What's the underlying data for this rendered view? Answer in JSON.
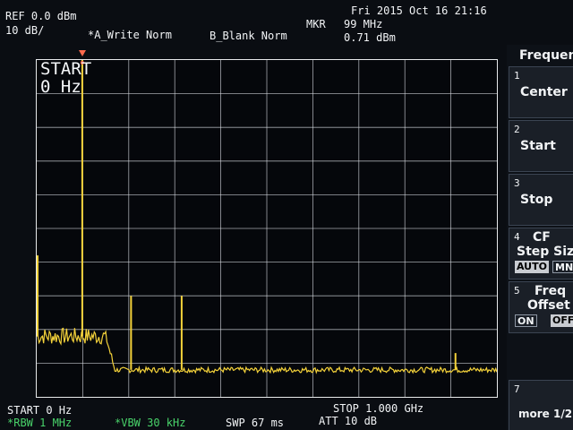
{
  "header": {
    "ref_level": "REF 0.0 dBm",
    "scale": "10 dB/",
    "trace_a": "*A_Write Norm",
    "trace_b": "B_Blank Norm",
    "datetime": "Fri 2015 Oct 16 21:16",
    "marker_label": "MKR",
    "marker_freq": "99 MHz",
    "marker_level": "0.71 dBm"
  },
  "plot_overlay": {
    "line1": "START",
    "line2": "0 Hz"
  },
  "footer": {
    "start": "START 0 Hz",
    "stop": "STOP 1.000 GHz",
    "rbw": "*RBW 1 MHz",
    "vbw": "*VBW 30 kHz",
    "sweep": "SWP 67 ms",
    "atten": "ATT 10 dB"
  },
  "softkeys": {
    "menu_title": "Frequency",
    "keys": [
      {
        "num": "1",
        "label": "Center"
      },
      {
        "num": "2",
        "label": "Start"
      },
      {
        "num": "3",
        "label": "Stop"
      },
      {
        "num": "4",
        "label_line1": "CF",
        "label_line2": "Step Size",
        "opt_on": "AUTO",
        "opt_off": "MNL"
      },
      {
        "num": "5",
        "label_line1": "Freq",
        "label_line2": "Offset",
        "opt_on": "ON",
        "opt_off": "OFF"
      },
      {
        "num": "7",
        "label": "more 1/2"
      }
    ]
  },
  "colors": {
    "trace": "#f4d23a",
    "grid": "#d9dde2",
    "marker": "#ff6a4d",
    "status_green": "#49d36a"
  },
  "chart_data": {
    "type": "line",
    "xlabel": "",
    "ylabel": "",
    "x_unit": "MHz",
    "y_unit": "dBm",
    "xlim": [
      0,
      1000
    ],
    "ylim": [
      -100,
      0
    ],
    "grid": true,
    "noise_floor_dbm": -92,
    "low_band_level_dbm": -82,
    "low_band_end_mhz": 170,
    "peaks": [
      {
        "x": 0,
        "y": -58
      },
      {
        "x": 99,
        "y": 0.71
      },
      {
        "x": 205,
        "y": -70
      },
      {
        "x": 315,
        "y": -70
      },
      {
        "x": 910,
        "y": -87
      }
    ],
    "marker": {
      "x": 99,
      "y": 0.71
    }
  }
}
